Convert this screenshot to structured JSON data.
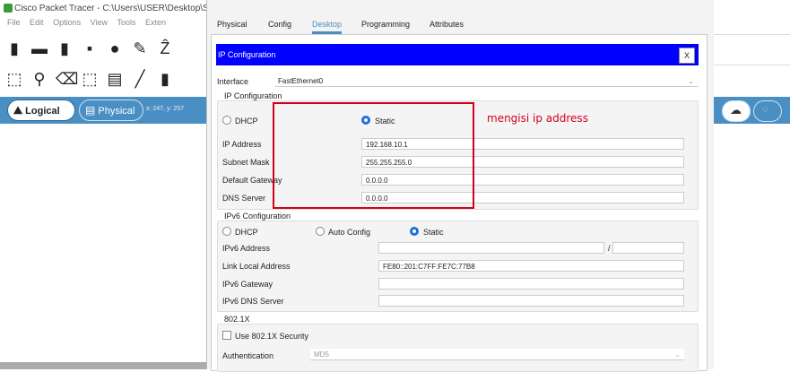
{
  "background_app": {
    "title": "Cisco Packet Tracer - C:\\Users\\USER\\Desktop\\S",
    "menu": [
      "File",
      "Edit",
      "Options",
      "View",
      "Tools",
      "Exten"
    ],
    "workspace_tabs": {
      "logical": "Logical",
      "physical": "Physical",
      "coords": "x: 247, y: 257"
    }
  },
  "dialog": {
    "tabs": [
      {
        "label": "Physical",
        "active": false
      },
      {
        "label": "Config",
        "active": false
      },
      {
        "label": "Desktop",
        "active": true
      },
      {
        "label": "Programming",
        "active": false
      },
      {
        "label": "Attributes",
        "active": false
      }
    ],
    "header_title": "IP Configuration",
    "close_label": "X",
    "interface_label": "Interface",
    "interface_value": "FastEthernet0",
    "ipv4": {
      "group_label": "IP Configuration",
      "dhcp_label": "DHCP",
      "static_label": "Static",
      "mode": "Static",
      "ip_address_label": "IP Address",
      "ip_address": "192.168.10.1",
      "subnet_mask_label": "Subnet Mask",
      "subnet_mask": "255.255.255.0",
      "gateway_label": "Default Gateway",
      "gateway": "0.0.0.0",
      "dns_label": "DNS Server",
      "dns": "0.0.0.0"
    },
    "ipv6": {
      "group_label": "IPv6 Configuration",
      "dhcp_label": "DHCP",
      "auto_label": "Auto Config",
      "static_label": "Static",
      "mode": "Static",
      "address_label": "IPv6 Address",
      "address": "",
      "prefix_sep": "/",
      "prefix": "",
      "link_local_label": "Link Local Address",
      "link_local": "FE80::201:C7FF:FE7C:77B8",
      "gateway_label": "IPv6 Gateway",
      "gateway": "",
      "dns_label": "IPv6 DNS Server",
      "dns": ""
    },
    "dot1x": {
      "group_label": "802.1X",
      "use_label": "Use 802.1X Security",
      "use_checked": false,
      "auth_label": "Authentication",
      "auth_value": "MD5"
    }
  },
  "annotation": {
    "text": "mengisi ip address",
    "color": "#d0021b"
  },
  "colors": {
    "header_blue": "#0000ff",
    "accent": "#4a8fc4",
    "radio_on": "#1e6fd9"
  }
}
